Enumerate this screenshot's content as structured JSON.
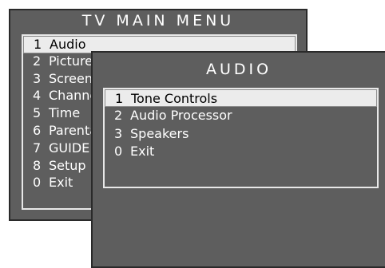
{
  "main_menu": {
    "title": "TV MAIN MENU",
    "items": [
      {
        "num": "1",
        "label": "Audio"
      },
      {
        "num": "2",
        "label": "Picture"
      },
      {
        "num": "3",
        "label": "Screen"
      },
      {
        "num": "4",
        "label": "Channels"
      },
      {
        "num": "5",
        "label": "Time"
      },
      {
        "num": "6",
        "label": "Parental"
      },
      {
        "num": "7",
        "label": "GUIDE"
      },
      {
        "num": "8",
        "label": "Setup"
      },
      {
        "num": "0",
        "label": "Exit"
      }
    ],
    "selected_index": 0
  },
  "audio_menu": {
    "title": "AUDIO",
    "items": [
      {
        "num": "1",
        "label": "Tone Controls"
      },
      {
        "num": "2",
        "label": "Audio Processor"
      },
      {
        "num": "3",
        "label": "Speakers"
      },
      {
        "num": "0",
        "label": "Exit"
      }
    ],
    "selected_index": 0
  },
  "colors": {
    "panel_bg": "#5e5e5e",
    "panel_border": "#2a2a2a",
    "highlight": "#ececec",
    "text": "#ffffff"
  }
}
